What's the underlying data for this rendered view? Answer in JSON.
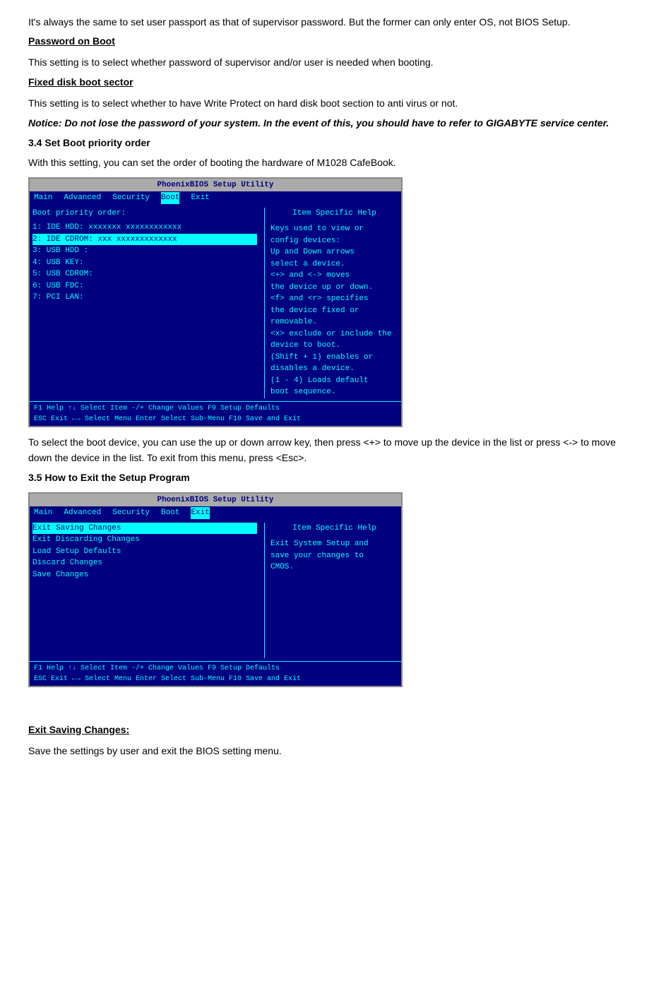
{
  "intro": {
    "paragraph1": "It's always the same to set user passport as that of supervisor password. But the former can only enter OS, not BIOS Setup."
  },
  "password_on_boot": {
    "heading": "Password on Boot",
    "text": "This setting is to select whether password of supervisor and/or user is needed when booting."
  },
  "fixed_disk": {
    "heading": "Fixed disk boot sector",
    "text": "This setting is to select whether to have Write Protect on hard disk boot section to anti virus or not."
  },
  "notice": {
    "text": "Notice: Do not lose the password of your system. In the event of this, you should have to refer to GIGABYTE service center."
  },
  "section34": {
    "heading": "3.4 Set Boot priority order",
    "intro": "With this setting, you can set the order of booting the hardware of M1028 CafeBook."
  },
  "bios1": {
    "title": "PhoenixBIOS Setup Utility",
    "menu": [
      "Main",
      "Advanced",
      "Security",
      "Boot",
      "Exit"
    ],
    "active_menu": "Boot",
    "left_content": [
      "Boot priority order:",
      "1:  IDE HDD:   xxxxxxx    xxxxxxxxxxxx",
      "2:  IDE CDROM: xxx        xxxxxxxxxxxxx",
      "3:  USB HDD :",
      "4:  USB KEY:",
      "5:  USB CDROM:",
      "6:  USB FDC:",
      "7:  PCI LAN:"
    ],
    "right_title": "Item Specific Help",
    "right_content": [
      "Keys used to view or",
      "config devices:",
      "Up and Down arrows",
      "select a device.",
      "<+> and <-> moves",
      "the device up  or down.",
      "<f> and <r> specifies",
      "the device fixed or removable.",
      "<x> exclude or include the",
      "device to boot.",
      "(Shift + 1) enables or",
      "disables a device.",
      "(1 - 4) Loads default",
      "boot sequence."
    ],
    "footer1": "F1   Help  ↑↓ Select Item   -/+    Change Values    F9  Setup Defaults",
    "footer2": "ESC  Exit  ←→ Select Menu   Enter  Select Sub-Menu  F10 Save and Exit"
  },
  "boot_description": {
    "text1": "To select the boot device, you can use the up or down arrow key, then press <+> to move up the device in the list or press <-> to move down the device in the list. To exit from this menu, press <Esc>."
  },
  "section35": {
    "heading": "3.5 How to Exit the Setup Program"
  },
  "bios2": {
    "title": "PhoenixBIOS Setup Utility",
    "menu": [
      "Main",
      "Advanced",
      "Security",
      "Boot",
      "Exit"
    ],
    "active_menu": "Exit",
    "left_content": [
      "Exit Saving Changes",
      "Exit Discarding Changes",
      "Load Setup Defaults",
      "Discard Changes",
      "Save Changes"
    ],
    "right_title": "Item Specific Help",
    "right_content": [
      "Exit System Setup and",
      "save your changes to",
      "CMOS."
    ],
    "footer1": "F1   Help  ↑↓ Select Item   -/+    Change Values    F9  Setup Defaults",
    "footer2": "ESC  Exit  ←→ Select Menu   Enter  Select Sub-Menu  F10 Save and Exit"
  },
  "exit_saving": {
    "heading": "Exit Saving Changes:",
    "text": "Save the settings by user and exit the BIOS setting menu."
  }
}
